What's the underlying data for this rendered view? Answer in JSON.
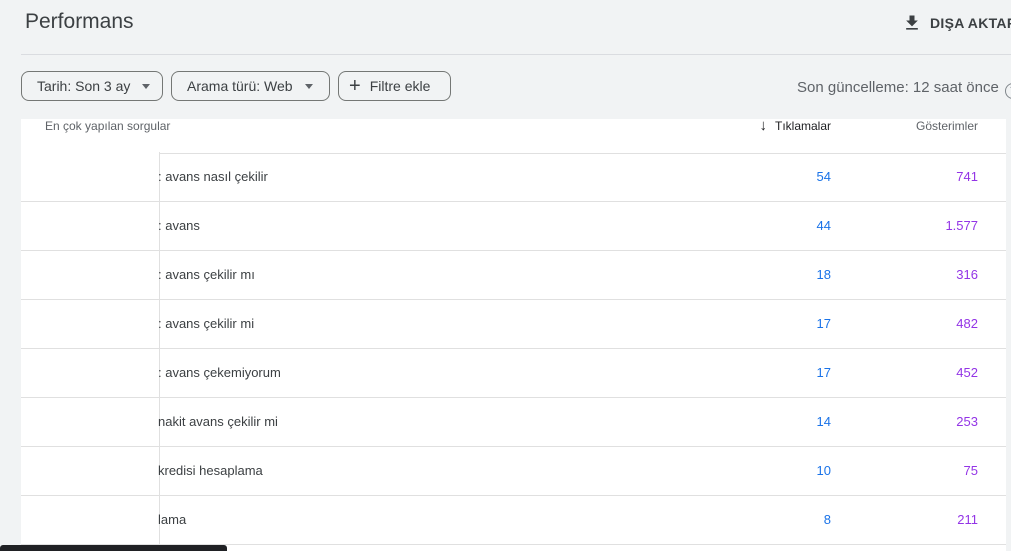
{
  "header": {
    "title": "Performans",
    "export_label": "DIŞA AKTAR"
  },
  "filters": {
    "date": "Tarih: Son 3 ay",
    "search_type": "Arama türü: Web",
    "add_filter": "Filtre ekle",
    "last_update": "Son güncelleme: 12 saat önce"
  },
  "table": {
    "headers": {
      "query": "En çok yapılan sorgular",
      "clicks": "Tıklamalar",
      "impressions": "Gösterimler"
    },
    "rows": [
      {
        "query": ": avans nasıl çekilir",
        "clicks": "54",
        "impressions": "741"
      },
      {
        "query": ": avans",
        "clicks": "44",
        "impressions": "1.577"
      },
      {
        "query": ": avans çekilir mı",
        "clicks": "18",
        "impressions": "316"
      },
      {
        "query": ": avans çekilir mi",
        "clicks": "17",
        "impressions": "482"
      },
      {
        "query": ": avans çekemiyorum",
        "clicks": "17",
        "impressions": "452"
      },
      {
        "query": " nakit avans çekilir mi",
        "clicks": "14",
        "impressions": "253"
      },
      {
        "query": "kredisi hesaplama",
        "clicks": "10",
        "impressions": "75"
      },
      {
        "query": "lama",
        "clicks": "8",
        "impressions": "211"
      }
    ]
  },
  "colors": {
    "clicks": "#1a73e8",
    "impressions": "#9334e6",
    "background": "#f1f3f4"
  },
  "icons": {
    "export": "download-icon",
    "add_filter": "plus-icon",
    "dropdown": "caret-down-icon",
    "sort": "arrow-down-icon",
    "help": "help-circle-icon"
  }
}
